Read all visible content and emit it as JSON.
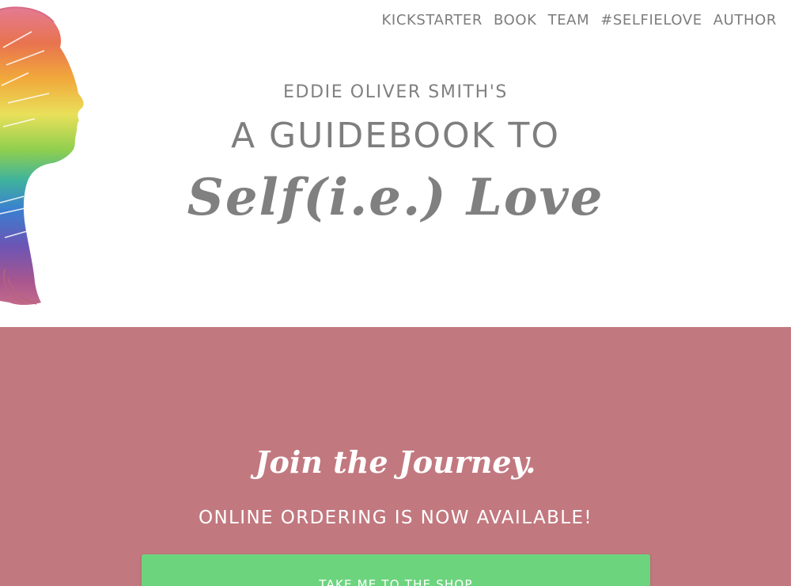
{
  "nav": {
    "items": [
      {
        "label": "KICKSTARTER"
      },
      {
        "label": "BOOK"
      },
      {
        "label": "TEAM"
      },
      {
        "label": "#SELFIELOVE"
      },
      {
        "label": "AUTHOR"
      }
    ]
  },
  "hero": {
    "author": "EDDIE OLIVER SMITH'S",
    "title": "A GUIDEBOOK TO",
    "script_title": "Self(i.e.) Love"
  },
  "journey": {
    "heading": "Join the Journey.",
    "ordering": "ONLINE ORDERING IS NOW AVAILABLE!",
    "button_label": "TAKE ME TO THE SHOP"
  },
  "colors": {
    "section_background": "#c2787f",
    "button_background": "#6dd47e",
    "text_gray": "#7e7e7e"
  }
}
